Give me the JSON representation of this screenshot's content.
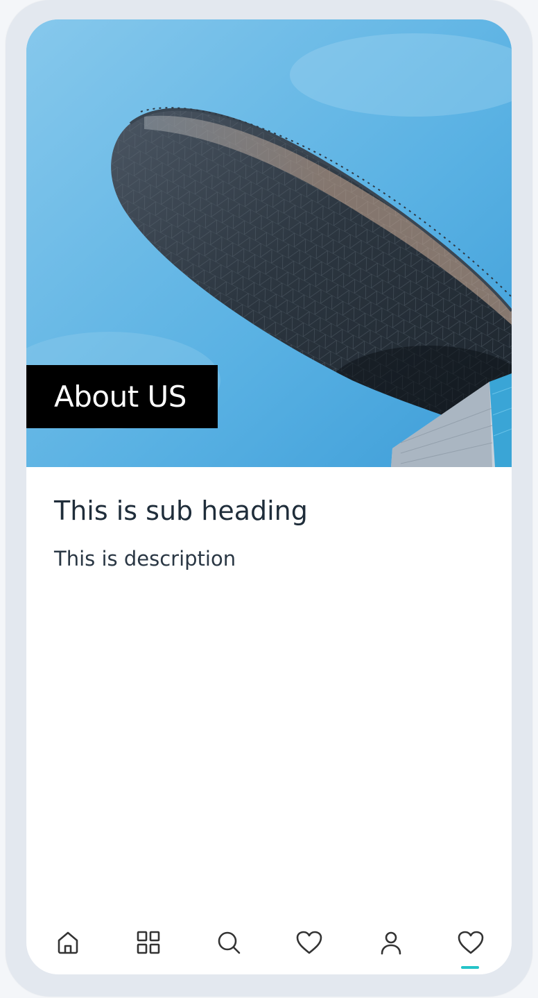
{
  "hero": {
    "title": "About US"
  },
  "content": {
    "sub_heading": "This is sub heading",
    "description": "This is description"
  },
  "bottom_nav": {
    "items": [
      {
        "icon": "home-icon"
      },
      {
        "icon": "grid-icon"
      },
      {
        "icon": "search-icon"
      },
      {
        "icon": "heart-icon"
      },
      {
        "icon": "user-icon"
      },
      {
        "icon": "heart-icon",
        "active": true
      }
    ]
  },
  "colors": {
    "accent": "#25c3c8",
    "text": "#1f2d3a",
    "sky": "#5fb4e4",
    "title_bg": "#000000"
  }
}
